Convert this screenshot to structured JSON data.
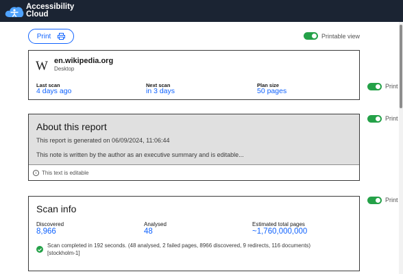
{
  "app": {
    "logo_line1": "Accessibility",
    "logo_line2": "Cloud",
    "logo_icon": "cloud-accessibility-icon"
  },
  "toolbar": {
    "print_label": "Print",
    "print_icon": "printer-icon",
    "printable_view_label": "Printable view",
    "printable_view_on": true
  },
  "site": {
    "logo": "W",
    "domain": "en.wikipedia.org",
    "device": "Desktop",
    "stats": [
      {
        "label": "Last scan",
        "value": "4 days ago"
      },
      {
        "label": "Next scan",
        "value": "in 3 days"
      },
      {
        "label": "Plan size",
        "value": "50 pages"
      }
    ]
  },
  "section_toggles": [
    {
      "label": "Print",
      "on": true
    },
    {
      "label": "Print",
      "on": true
    },
    {
      "label": "Print",
      "on": true
    }
  ],
  "about": {
    "title": "About this report",
    "generated": "This report is generated on 06/09/2024, 11:06:44",
    "note": "This note is written by the author as an executive summary and is editable...",
    "editable_hint": "This text is editable"
  },
  "scan_info": {
    "title": "Scan info",
    "stats": [
      {
        "label": "Discovered",
        "value": "8,966"
      },
      {
        "label": "Analysed",
        "value": "48"
      },
      {
        "label": "Estimated total pages",
        "value": "~1,760,000,000"
      }
    ],
    "summary_line1": "Scan completed in 192 seconds. (48 analysed, 2 failed pages, 8966 discovered, 9 redirects, 116 documents)",
    "summary_line2": "[stockholm-1]"
  },
  "colors": {
    "accent": "#0f62fe",
    "success": "#24a148",
    "header_bg": "#1b2433"
  }
}
